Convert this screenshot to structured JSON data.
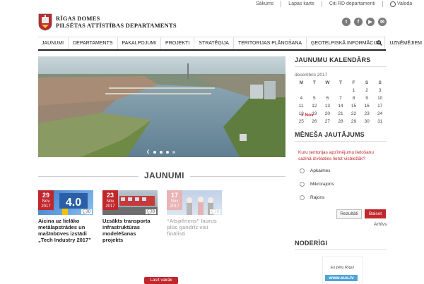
{
  "topbar": {
    "links": [
      "Sākums",
      "Lapas karte",
      "Citi RD departamenti"
    ],
    "language": "Valoda"
  },
  "logo": {
    "line1": "RĪGAS DOMES",
    "line2": "PILSĒTAS ATTĪSTĪBAS DEPARTAMENTS"
  },
  "socials": [
    "twitter-icon",
    "facebook-icon",
    "youtube-icon",
    "email-icon"
  ],
  "nav": {
    "items": [
      "JAUNUMI",
      "DEPARTAMENTS",
      "PAKALPOJUMI",
      "PROJEKTI",
      "STRATĒĢIJA",
      "TERITORIJAS PLĀNOŠANA",
      "ĢEOTELPISKĀ INFORMĀCIJA",
      "UZŅĒMĒJIEM"
    ]
  },
  "news": {
    "title": "JAUNUMI",
    "cards": [
      {
        "day": "29",
        "month": "Nov",
        "year": "2017",
        "comments": "0",
        "title": "Aicina uz lielāko metālapstrādes un mašīnbūves izstādi „Tech Industry 2017”"
      },
      {
        "day": "23",
        "month": "Nov",
        "year": "2017",
        "comments": "0",
        "title": "Uzsākts transporta infrastruktūras modelēšanas projekts"
      },
      {
        "day": "17",
        "month": "Nov",
        "year": "2017",
        "comments": "0",
        "title": "“Atspēriens” laurus plūc gandrīz visi finālisti"
      }
    ],
    "more_label": "Lasīt vairāk"
  },
  "calendar": {
    "title": "JAUNUMU KALENDĀRS",
    "month_label": "decembris 2017",
    "weekdays": [
      "M",
      "T",
      "W",
      "T",
      "F",
      "S",
      "S"
    ],
    "weeks": [
      [
        "",
        "",
        "",
        "",
        "1",
        "2",
        "3"
      ],
      [
        "4",
        "5",
        "6",
        "7",
        "8",
        "9",
        "10"
      ],
      [
        "11",
        "12",
        "13",
        "14",
        "15",
        "16",
        "17"
      ],
      [
        "18",
        "19",
        "20",
        "21",
        "22",
        "23",
        "24"
      ],
      [
        "25",
        "26",
        "27",
        "28",
        "29",
        "30",
        "31"
      ]
    ],
    "prev_label": "« Nov"
  },
  "poll": {
    "title": "MĒNEŠA JAUTĀJUMS",
    "question": "Kuru teritorijas apzīmējumu lietošanu sazinā izvēlaties lietot visbiežāk?",
    "options": [
      "Apkaimes",
      "Mikrorajons",
      "Rajons"
    ],
    "results_label": "Rezultāti",
    "vote_label": "Balsot",
    "archive_label": "Arhīvs"
  },
  "noderigi": {
    "title": "NODERĪGI",
    "banner_text": "Es pētu Rīgu!",
    "banner_link": "www.sus.lv"
  },
  "colors": {
    "accent": "#c0272d",
    "nav_border": "#222222"
  }
}
